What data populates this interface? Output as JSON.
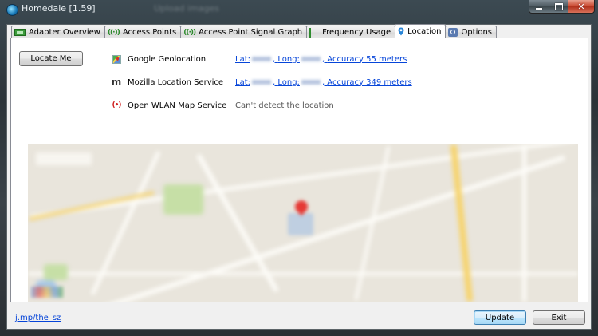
{
  "window": {
    "title": "Homedale [1.59]",
    "background_window_title": "Upload images"
  },
  "tabs": [
    {
      "label": "Adapter Overview",
      "icon": "network-adapter-icon"
    },
    {
      "label": "Access Points",
      "icon": "wifi-signal-icon"
    },
    {
      "label": "Access Point Signal Graph",
      "icon": "wifi-signal-icon"
    },
    {
      "label": "Frequency Usage",
      "icon": "bar-graph-icon"
    },
    {
      "label": "Location",
      "icon": "location-pin-icon",
      "active": true
    },
    {
      "label": "Options",
      "icon": "options-icon"
    }
  ],
  "location": {
    "locate_button": "Locate Me",
    "services": [
      {
        "name": "Google Geolocation",
        "icon": "google-maps-icon",
        "lat_label": "Lat:",
        "long_label": "Long:",
        "accuracy": "Accuracy 55 meters"
      },
      {
        "name": "Mozilla Location Service",
        "icon": "mozilla-icon",
        "lat_label": "Lat:",
        "long_label": "Long:",
        "accuracy": "Accuracy 349 meters"
      },
      {
        "name": "Open WLAN Map Service",
        "icon": "wlan-signal-icon",
        "status": "Can't detect the location"
      }
    ]
  },
  "footer": {
    "link": "j.mp/the_sz",
    "update_button": "Update",
    "exit_button": "Exit"
  },
  "colors": {
    "link": "#0645d9",
    "window_frame": "#2b3338",
    "close_button": "#c8442b",
    "default_button": "#a7d9f5"
  }
}
